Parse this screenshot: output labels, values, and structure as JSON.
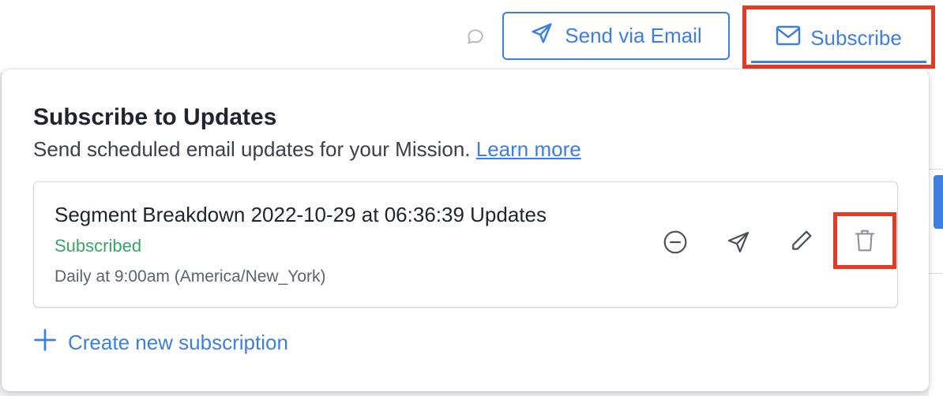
{
  "toolbar": {
    "comment_icon": "comment-icon",
    "send_email_label": "Send via Email",
    "send_email_icon": "paper-plane-icon",
    "subscribe_label": "Subscribe",
    "subscribe_icon": "envelope-icon"
  },
  "panel": {
    "title": "Subscribe to Updates",
    "description": "Send scheduled email updates for your Mission.",
    "learn_more": "Learn more",
    "subscriptions": [
      {
        "name": "Segment Breakdown 2022-10-29 at 06:36:39 Updates",
        "status": "Subscribed",
        "schedule": "Daily at 9:00am (America/New_York)",
        "actions": [
          "minus-circle-icon",
          "paper-plane-icon",
          "pencil-icon",
          "trash-icon"
        ]
      }
    ],
    "create_label": "Create new subscription"
  },
  "colors": {
    "accent": "#3d7fe0",
    "status_subscribed": "#3aa36a",
    "highlight": "#e63a23"
  }
}
